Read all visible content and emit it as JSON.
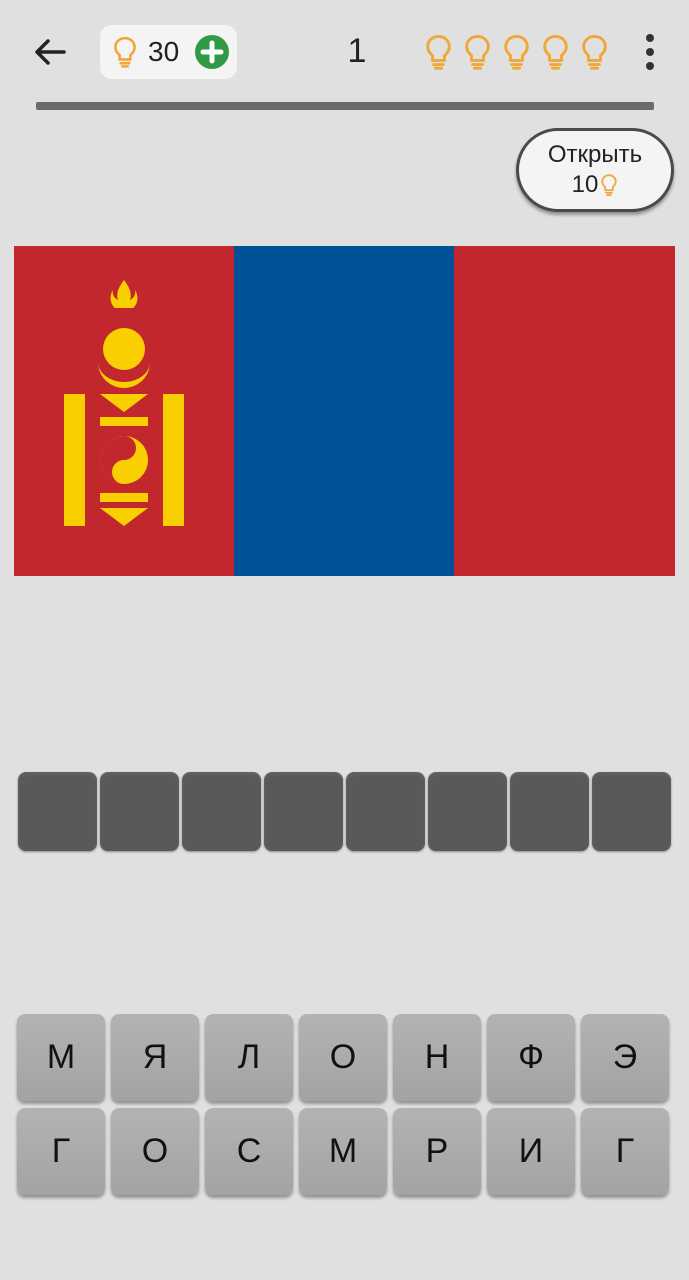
{
  "header": {
    "hints_count": "30",
    "level": "1",
    "level_hint_bulbs": [
      "bulb-icon",
      "bulb-icon",
      "bulb-icon",
      "bulb-icon",
      "bulb-icon"
    ]
  },
  "open_button": {
    "label": "Открыть",
    "cost": "10"
  },
  "flag": {
    "colors": {
      "red": "#c1272d",
      "blue": "#015197",
      "yellow": "#f9cf02"
    }
  },
  "answer": {
    "slot_count": 8
  },
  "keyboard": {
    "rows": [
      [
        "М",
        "Я",
        "Л",
        "О",
        "Н",
        "Ф",
        "Э"
      ],
      [
        "Г",
        "О",
        "С",
        "М",
        "Р",
        "И",
        "Г"
      ]
    ]
  },
  "colors": {
    "background": "#e0e0e0",
    "bulb": "#f0a73a",
    "plus": "#2f9a47",
    "slot": "#595959",
    "key": "#a8a8a8"
  }
}
